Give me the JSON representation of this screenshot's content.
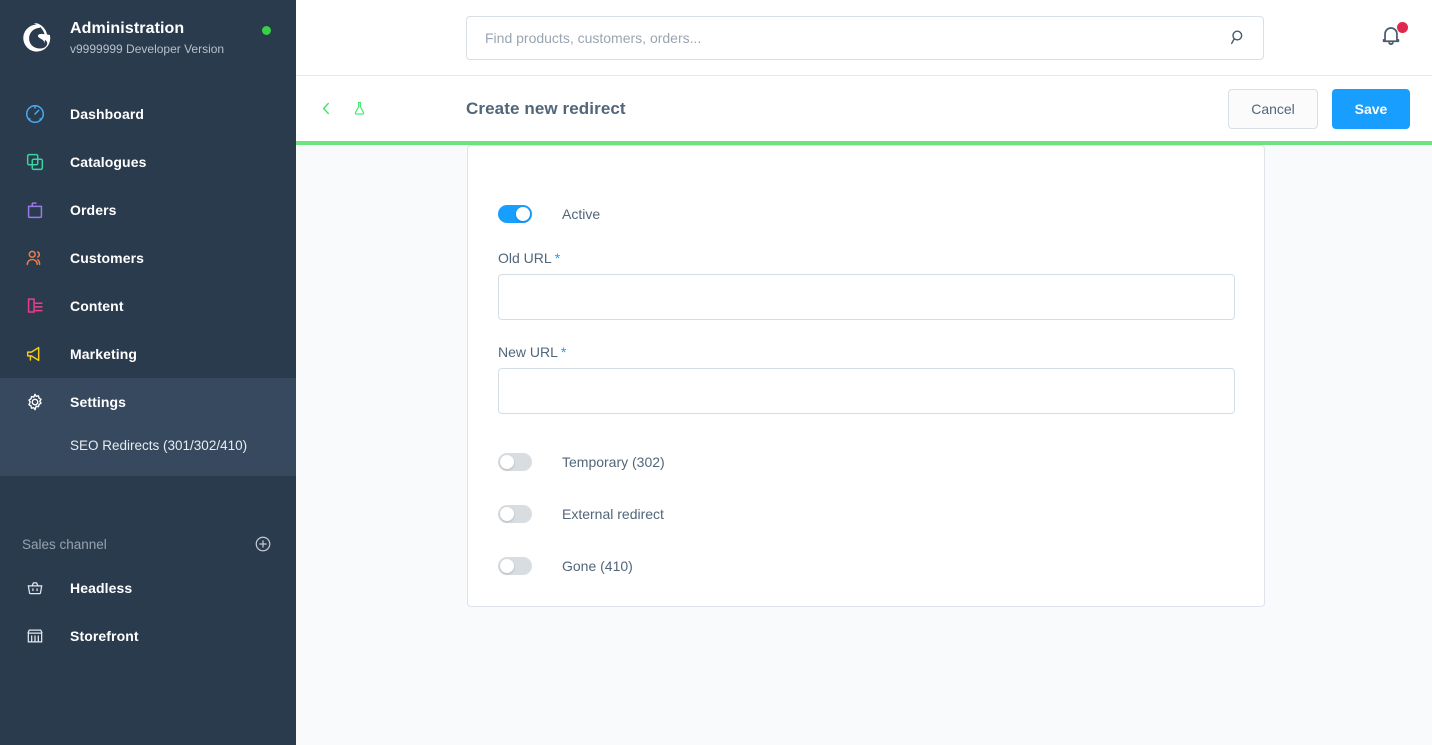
{
  "sidebar": {
    "logo_icon": "shopware-logo-icon",
    "title": "Administration",
    "version": "v9999999 Developer Version",
    "status_dot": "online-status-dot",
    "items": [
      {
        "label": "Dashboard",
        "icon": "dashboard-icon",
        "color": "#4babf2"
      },
      {
        "label": "Catalogues",
        "icon": "catalogues-icon",
        "color": "#37d6a0"
      },
      {
        "label": "Orders",
        "icon": "orders-icon",
        "color": "#9b7be8"
      },
      {
        "label": "Customers",
        "icon": "customers-icon",
        "color": "#ef7e4a"
      },
      {
        "label": "Content",
        "icon": "content-icon",
        "color": "#ed3c8d"
      },
      {
        "label": "Marketing",
        "icon": "marketing-icon",
        "color": "#f2cb1d"
      },
      {
        "label": "Settings",
        "icon": "gear-icon",
        "color": "#ffffff"
      }
    ],
    "settings_children": [
      {
        "label": "SEO Redirects (301/302/410)"
      }
    ],
    "sales_channel": {
      "heading": "Sales channel",
      "add_icon": "plus-circle-icon",
      "channels": [
        {
          "label": "Headless",
          "icon": "basket-icon"
        },
        {
          "label": "Storefront",
          "icon": "storefront-icon"
        }
      ]
    }
  },
  "topbar": {
    "search": {
      "placeholder": "Find products, customers, orders...",
      "value": "",
      "icon": "search-icon"
    },
    "notifications": {
      "icon": "bell-icon",
      "has_unread": true,
      "badge_color": "#de294c"
    }
  },
  "smart_bar": {
    "back_icon": "chevron-left-icon",
    "flask_icon": "flask-icon",
    "icon_color": "#3ce76a",
    "title": "Create new redirect",
    "cancel_label": "Cancel",
    "save_label": "Save",
    "save_color": "#189eff"
  },
  "progress": {
    "color": "#6ce283",
    "percent": 100
  },
  "form": {
    "active_toggle": {
      "label": "Active",
      "on": true
    },
    "old_url": {
      "label": "Old URL",
      "required": "*",
      "value": "",
      "placeholder": ""
    },
    "new_url": {
      "label": "New URL",
      "required": "*",
      "value": "",
      "placeholder": ""
    },
    "options": [
      {
        "label": "Temporary (302)",
        "on": false
      },
      {
        "label": "External redirect",
        "on": false
      },
      {
        "label": "Gone (410)",
        "on": false
      }
    ]
  }
}
